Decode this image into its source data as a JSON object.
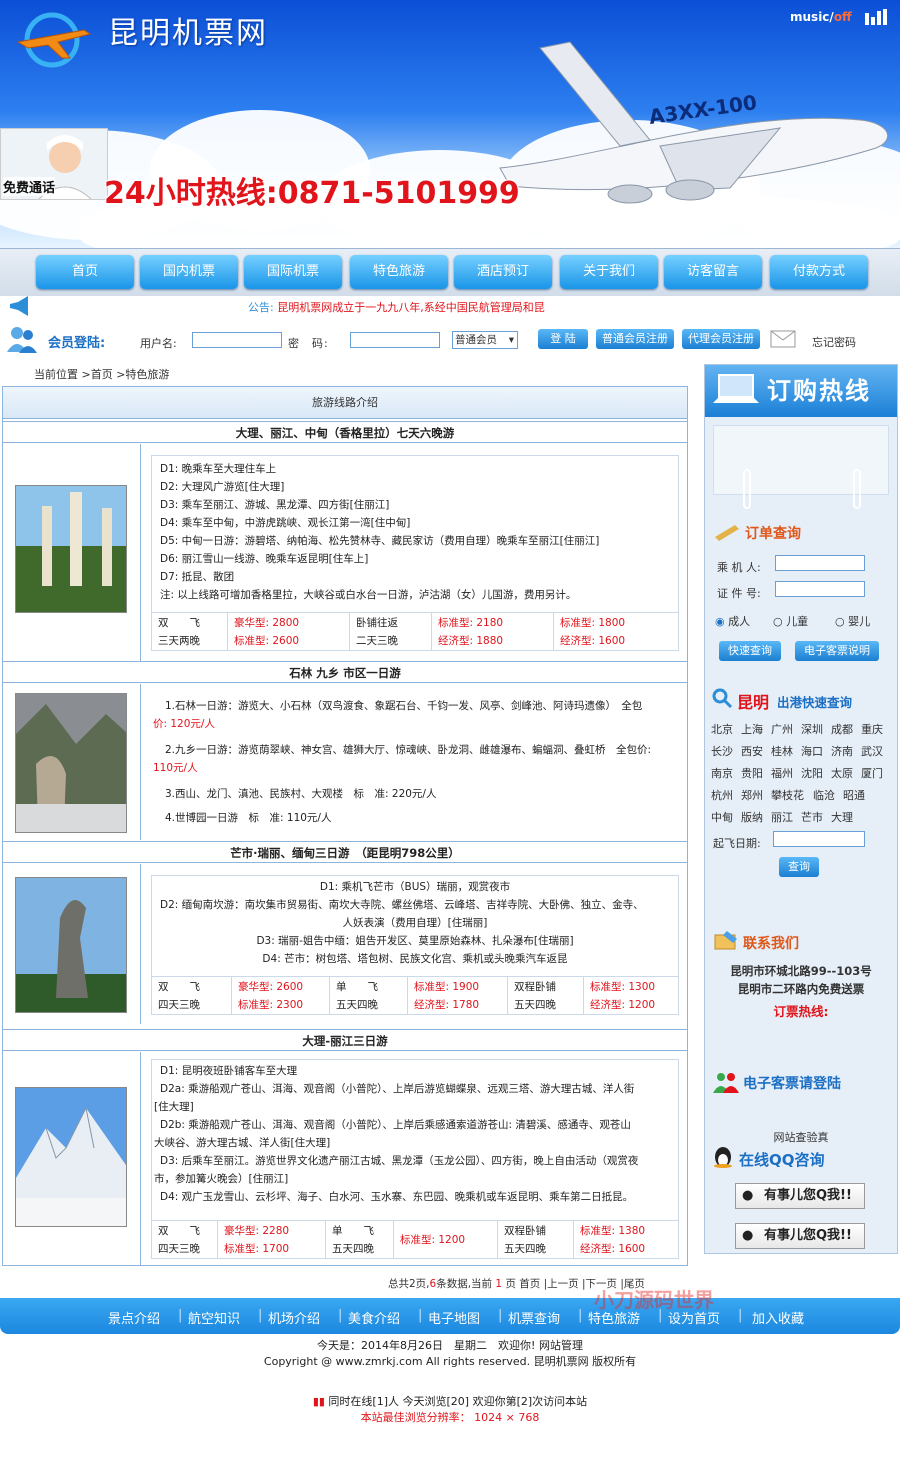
{
  "header": {
    "site_title": "昆明机票网",
    "music_label": "music/",
    "music_off": "off",
    "hotline": "24小时热线:0871-5101999",
    "free_call": "免费通话"
  },
  "nav": [
    "首页",
    "国内机票",
    "国际机票",
    "特色旅游",
    "酒店预订",
    "关于我们",
    "访客留言",
    "付款方式"
  ],
  "notice": {
    "label": "公告:",
    "text": "昆明机票网成立于一九九八年,系经中国民航管理局和昆"
  },
  "login": {
    "title": "会员登陆:",
    "username_label": "用户名:",
    "password_label": "密　码:",
    "member_type": "普通会员",
    "login_btn": "登 陆",
    "reg_normal": "普通会员注册",
    "reg_agent": "代理会员注册",
    "forgot": "忘记密码"
  },
  "breadcrumb": "当前位置 >首页 >特色旅游",
  "main": {
    "heading": "旅游线路介绍",
    "routes": [
      {
        "title": "大理、丽江、中甸（香格里拉）七天六晚游",
        "lines": [
          "D1: 晚乘车至大理住车上",
          "D2: 大理风广游览[住大理]",
          "D3: 乘车至丽江、游城、黑龙潭、四方街[住丽江]",
          "D4: 乘车至中甸，中游虎跳峡、观长江第一湾[住中甸]",
          "D5: 中甸一日游：游碧塔、纳帕海、松先赞林寺、藏民家访（费用自理）晚乘车至丽江[住丽江]",
          "D6: 丽江雪山一线游、晚乘车返昆明[住车上]",
          "D7: 抵昆、散团",
          "注: 以上线路可增加香格里拉，大峡谷或白水台一日游，泸沽湖（女）儿国游，费用另计。"
        ],
        "prices": [
          {
            "a": "双　　飞",
            "b": "三天两晚"
          },
          {
            "a": "豪华型: 2800",
            "b": "标准型: 2600",
            "red": true
          },
          {
            "a": "卧铺往返",
            "b": "二天三晚"
          },
          {
            "a": "标准型: 2180",
            "b": "经济型: 1880",
            "red": true
          },
          {
            "a": "标准型: 1800",
            "b": "经济型: 1600",
            "red": true
          }
        ]
      },
      {
        "title": "石林 九乡 市区一日游",
        "lines": [
          "1.石林一日游：游览大、小石林（双鸟渡食、象踞石台、千钧一发、风亭、剑峰池、阿诗玛遗像）　全包",
          "价: 120元/人",
          "2.九乡一日游：游览荫翠峡、神女宫、雄狮大厅、惊魂峡、卧龙洞、雌雄瀑布、蝙蝠洞、叠虹桥　全包价:",
          "110元/人",
          "3.西山、龙门、滇池、民族村、大观楼　标　准: 220元/人",
          "4.世博园一日游　标　准: 110元/人"
        ]
      },
      {
        "title": "芒市·瑞丽、缅甸三日游　（距昆明798公里）",
        "lines": [
          "D1: 乘机飞芒市（BUS）瑞丽，观赏夜市",
          "D2: 缅甸南坎游：南坎集市贸易街、南坎大寺院、螺丝佛塔、云峰塔、吉祥寺院、大卧佛、独立、金寺、",
          "人妖表演（费用自理）[住瑞丽]",
          "D3: 瑞丽-姐告中缅：姐告开发区、莫里原始森林、扎朵瀑布[住瑞丽]",
          "D4: 芒市：树包塔、塔包树、民族文化宫、乘机或头晚乘汽车返昆"
        ],
        "prices": [
          {
            "a": "双　　飞",
            "b": "四天三晚"
          },
          {
            "a": "豪华型: 2600",
            "b": "标准型: 2300",
            "red": true
          },
          {
            "a": "单　　飞",
            "b": "五天四晚"
          },
          {
            "a": "标准型: 1900",
            "b": "经济型: 1780",
            "red": true
          },
          {
            "a": "双程卧铺",
            "b": "五天四晚"
          },
          {
            "a": "标准型: 1300",
            "b": "经济型: 1200",
            "red": true
          }
        ]
      },
      {
        "title": "大理-丽江三日游",
        "lines": [
          "D1: 昆明夜班卧铺客车至大理",
          "D2a: 乘游船观广苍山、洱海、观音阁（小普陀）、上岸后游览蝴蝶泉、远观三塔、游大理古城、洋人街",
          "[住大理]",
          "D2b: 乘游船观广苍山、洱海、观音阁（小普陀）、上岸后乘感通索道游苍山: 清碧溪、感通寺、观苍山",
          "大峡谷、游大理古城、洋人街[住大理]",
          "D3: 后乘车至丽江。游览世界文化遗产丽江古城、黑龙潭（玉龙公园）、四方街，晚上自由活动（观赏夜",
          "市，参加篝火晚会）[住丽江]",
          "D4: 观广玉龙雪山、云杉坪、海子、白水河、玉水寨、东巴园、晚乘机或车返昆明、乘车第二日抵昆。"
        ],
        "prices": [
          {
            "a": "双　　飞",
            "b": "四天三晚"
          },
          {
            "a": "豪华型: 2280",
            "b": "标准型: 1700",
            "red": true
          },
          {
            "a": "单　　飞",
            "b": "五天四晚"
          },
          {
            "a": "标准型: 1200",
            "b": "",
            "red": true
          },
          {
            "a": "双程卧铺",
            "b": "五天四晚"
          },
          {
            "a": "标准型: 1380",
            "b": "经济型: 1600",
            "red": true
          }
        ]
      }
    ]
  },
  "pager": {
    "pre": "总共2页,",
    "count": "6",
    "mid": "条数据,当前",
    "cur": "1",
    "rest": "页 首页 |上一页 |下一页 |尾页"
  },
  "side": {
    "hot": "订购热线",
    "order_query": "订单查询",
    "passenger": "乘 机 人:",
    "id_no": "证 件 号:",
    "adult": "成人",
    "child": "儿童",
    "infant": "婴儿",
    "quick_query": "快速查询",
    "eticket": "电子客票说明",
    "kunming": "昆明",
    "departure": "出港快速查询",
    "cities": [
      [
        "北京",
        "上海",
        "广州",
        "深圳",
        "成都",
        "重庆"
      ],
      [
        "长沙",
        "西安",
        "桂林",
        "海口",
        "济南",
        "武汉"
      ],
      [
        "南京",
        "贵阳",
        "福州",
        "沈阳",
        "太原",
        "厦门"
      ],
      [
        "杭州",
        "郑州",
        "攀枝花",
        "临沧",
        "昭通"
      ],
      [
        "中甸",
        "版纳",
        "丽江",
        "芒市",
        "大理"
      ]
    ],
    "date_label": "起飞日期:",
    "query_btn": "查询",
    "contact": "联系我们",
    "addr1": "昆明市环城北路99--103号",
    "addr2": "昆明市二环路内免费送票",
    "order_hot": "订票热线:",
    "eticket_login": "电子客票请登陆",
    "verify": "网站查验真",
    "qq": "在线QQ咨询",
    "qq_btn": "有事儿您Q我!!"
  },
  "footer": {
    "links": [
      "景点介绍",
      "航空知识",
      "机场介绍",
      "美食介绍",
      "电子地图",
      "机票查询",
      "特色旅游",
      "设为首页",
      "加入收藏"
    ],
    "date": "今天是：2014年8月26日　星期二　欢迎你! 网站管理",
    "copyright": "Copyright @ www.zmrkj.com All rights reserved. 昆明机票网 版权所有",
    "online": "同时在线[1]人 今天浏览[20] 欢迎你第[2]次访问本站",
    "resolution": "本站最佳浏览分辨率： 1024 × 768"
  },
  "watermark": "小刀源码世界",
  "colors": {
    "accent": "#1b87df",
    "red": "#e1141b",
    "border": "#8db4dc"
  }
}
